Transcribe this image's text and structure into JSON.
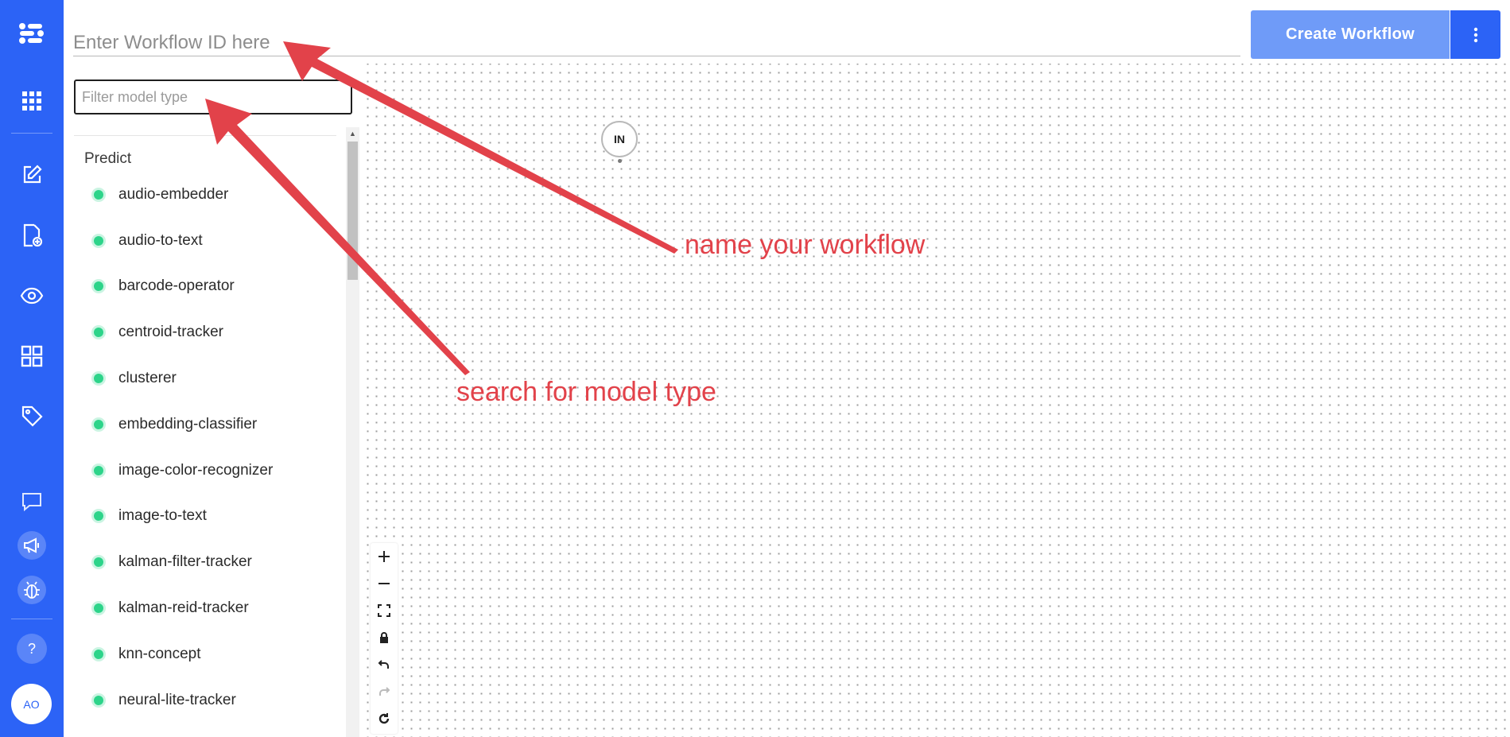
{
  "header": {
    "workflow_id_placeholder": "Enter Workflow ID here",
    "create_button_label": "Create Workflow"
  },
  "sidebar": {
    "filter_placeholder": "Filter model type",
    "group_label": "Predict",
    "models": [
      "audio-embedder",
      "audio-to-text",
      "barcode-operator",
      "centroid-tracker",
      "clusterer",
      "embedding-classifier",
      "image-color-recognizer",
      "image-to-text",
      "kalman-filter-tracker",
      "kalman-reid-tracker",
      "knn-concept",
      "neural-lite-tracker"
    ]
  },
  "canvas": {
    "input_node_label": "IN"
  },
  "nav": {
    "items": [
      "logo-icon",
      "apps-grid-icon",
      "edit-icon",
      "file-add-icon",
      "eye-icon",
      "dashboard-icon",
      "tag-icon",
      "chat-icon",
      "megaphone-icon",
      "bug-icon"
    ],
    "help_label": "?",
    "avatar_initials": "AO"
  },
  "annotations": {
    "workflow_note": "name your workflow",
    "model_type_note": "search for model type"
  },
  "colors": {
    "nav_bg": "#2c63f6",
    "create_button_bg": "#6f9bf8",
    "model_dot": "#2dd48a",
    "annotation": "#e2424a"
  }
}
